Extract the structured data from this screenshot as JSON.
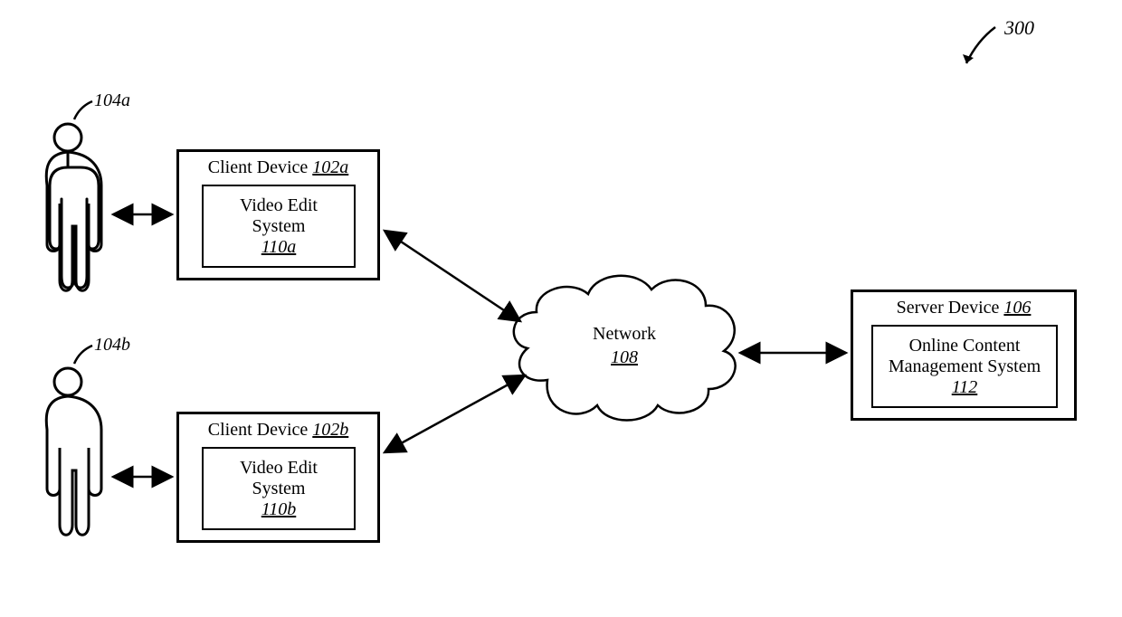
{
  "figure_ref": "300",
  "user_a_ref": "104a",
  "user_b_ref": "104b",
  "client_a": {
    "title_prefix": "Client Device ",
    "title_ref": "102a",
    "inner_line1": "Video Edit",
    "inner_line2": "System",
    "inner_ref": "110a"
  },
  "client_b": {
    "title_prefix": "Client Device ",
    "title_ref": "102b",
    "inner_line1": "Video Edit",
    "inner_line2": "System",
    "inner_ref": "110b"
  },
  "network": {
    "label": "Network",
    "ref": "108"
  },
  "server": {
    "title_prefix": "Server Device ",
    "title_ref": "106",
    "inner_line1": "Online Content",
    "inner_line2": "Management System",
    "inner_ref": "112"
  }
}
